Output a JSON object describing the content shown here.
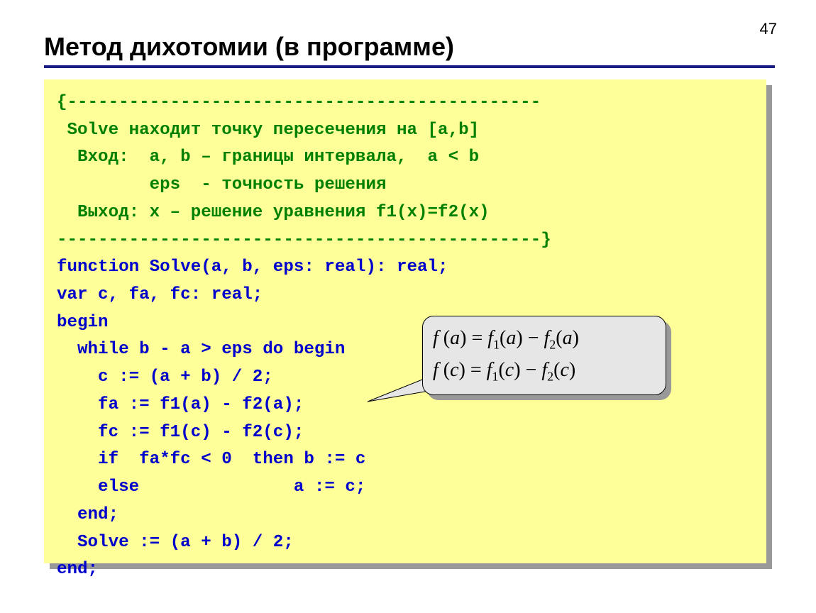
{
  "page_number": "47",
  "title": "Метод дихотомии (в программе)",
  "code": {
    "c1": "{----------------------------------------------",
    "c2": " Solve находит точку пересечения на [a,b]",
    "c3": "  Вход:  a, b – границы интервала,  a < b",
    "c4": "         eps  - точность решения",
    "c5": "  Выход: x – решение уравнения f1(x)=f2(x)",
    "c6": "-----------------------------------------------}",
    "l1": "function Solve(a, b, eps: real): real;",
    "l2": "var c, fa, fc: real;",
    "l3": "begin",
    "l4": "  while b - a > eps do begin",
    "l5": "    c := (a + b) / 2;",
    "l6": "    fa := f1(a) - f2(a);",
    "l7": "    fc := f1(c) - f2(c);",
    "l8": "    if  fa*fc < 0  then b := c",
    "l9": "    else               a := c;",
    "l10": "  end;",
    "l11": "  Solve := (a + b) / 2;",
    "l12": "end;"
  },
  "callout": {
    "formula1_parts": {
      "pre": "f",
      "arg1": "a",
      "eq": " = ",
      "f1": "f",
      "s1": "1",
      "arg2": "a",
      "minus": " − ",
      "f2": "f",
      "s2": "2",
      "arg3": "a"
    },
    "formula2_parts": {
      "pre": "f",
      "arg1": "c",
      "eq": " = ",
      "f1": "f",
      "s1": "1",
      "arg2": "c",
      "minus": " − ",
      "f2": "f",
      "s2": "2",
      "arg3": "c"
    }
  }
}
